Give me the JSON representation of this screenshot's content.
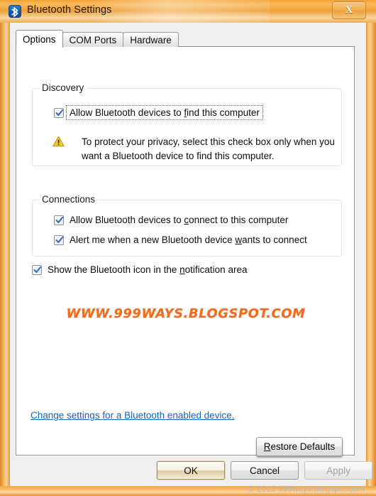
{
  "window": {
    "title": "Bluetooth Settings",
    "app_icon": "bluetooth-icon",
    "close_label": "X",
    "frame_color": "#e8942c",
    "titlebar_color": "#f3a236"
  },
  "tabs": [
    {
      "label": "Options",
      "active": true
    },
    {
      "label": "COM Ports",
      "active": false
    },
    {
      "label": "Hardware",
      "active": false
    }
  ],
  "discovery": {
    "legend": "Discovery",
    "checkbox": {
      "checked": true,
      "focused": true,
      "text_before": "Allow Bluetooth devices to ",
      "accel": "f",
      "text_after": "ind this computer"
    },
    "warning": {
      "icon": "warning-triangle-icon",
      "icon_color": "#f5c518",
      "text": "To protect your privacy, select this check box only when you want a Bluetooth device to find this computer."
    }
  },
  "connections": {
    "legend": "Connections",
    "checkboxes": [
      {
        "checked": true,
        "text_before": "Allow Bluetooth devices to ",
        "accel": "c",
        "text_after": "onnect to this computer"
      },
      {
        "checked": true,
        "text_before": "Alert me when a new Bluetooth device ",
        "accel": "w",
        "text_after": "ants to connect"
      }
    ]
  },
  "notification": {
    "checked": true,
    "text_before": "Show the Bluetooth icon in the ",
    "accel": "n",
    "text_after": "otification area"
  },
  "watermark": {
    "text": "WWW.999WAYS.BLOGSPOT.COM",
    "color": "#f26b1e"
  },
  "link": {
    "text": "Change settings for a Bluetooth enabled device.",
    "color": "#1165b5"
  },
  "restore_button": {
    "accel": "R",
    "text_after": "estore Defaults"
  },
  "buttons": {
    "ok": "OK",
    "cancel": "Cancel",
    "apply": "Apply",
    "apply_enabled": false
  },
  "copyright": "© 2013 999ways.blogspot.com"
}
